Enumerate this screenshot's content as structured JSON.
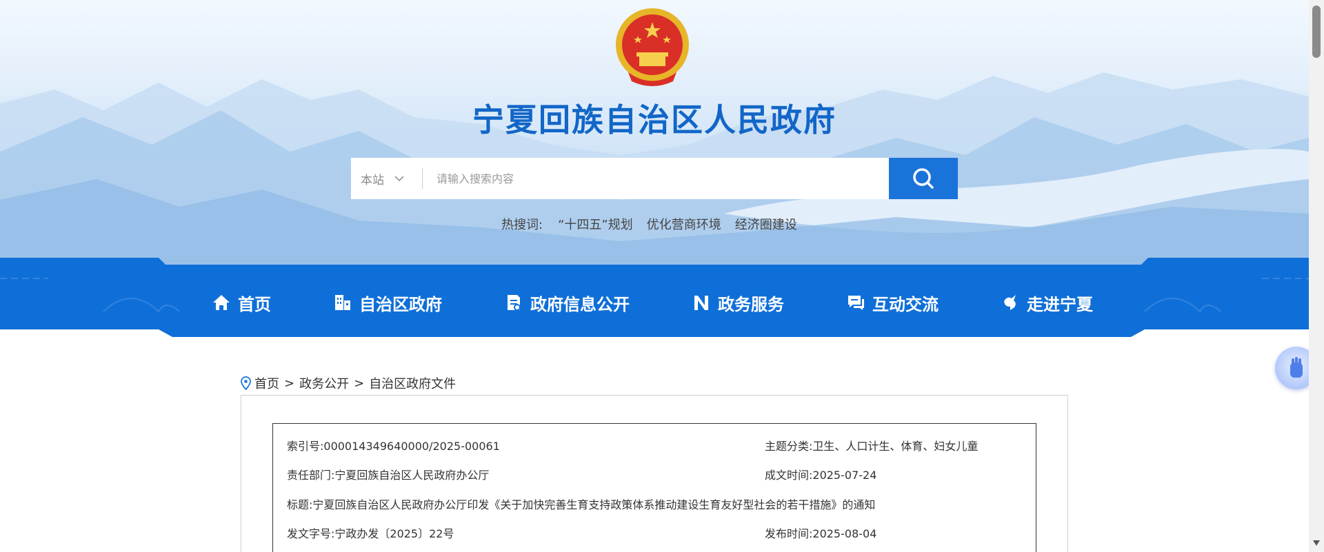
{
  "header": {
    "site_title": "宁夏回族自治区人民政府",
    "emblem_icon": "national-emblem-icon"
  },
  "search": {
    "scope": "本站",
    "placeholder": "请输入搜索内容",
    "button_icon": "search-icon"
  },
  "hot_search": {
    "label": "热搜词:",
    "items": [
      "“十四五”规划",
      "优化营商环境",
      "经济圈建设"
    ]
  },
  "nav": {
    "items": [
      {
        "label": "首页",
        "icon": "home-icon"
      },
      {
        "label": "自治区政府",
        "icon": "building-icon"
      },
      {
        "label": "政府信息公开",
        "icon": "document-icon"
      },
      {
        "label": "政务服务",
        "icon": "service-icon"
      },
      {
        "label": "互动交流",
        "icon": "chat-icon"
      },
      {
        "label": "走进宁夏",
        "icon": "bird-icon"
      }
    ]
  },
  "breadcrumb": {
    "items": [
      "首页",
      "政务公开",
      "自治区政府文件"
    ],
    "separator": ">"
  },
  "document_meta": {
    "index_no": "索引号:000014349640000/2025-00061",
    "subject": "主题分类:卫生、人口计生、体育、妇女儿童",
    "department": "责任部门:宁夏回族自治区人民政府办公厅",
    "written_date": "成文时间:2025-07-24",
    "title": "标题:宁夏回族自治区人民政府办公厅印发《关于加快完善生育支持政策体系推动建设生育友好型社会的若干措施》的通知",
    "doc_no": "发文字号:宁政办发〔2025〕22号",
    "publish_date": "发布时间:2025-08-04"
  },
  "colors": {
    "primary": "#1a73d9",
    "title_blue": "#1266c7",
    "nav_blue": "#0f6fd8"
  }
}
